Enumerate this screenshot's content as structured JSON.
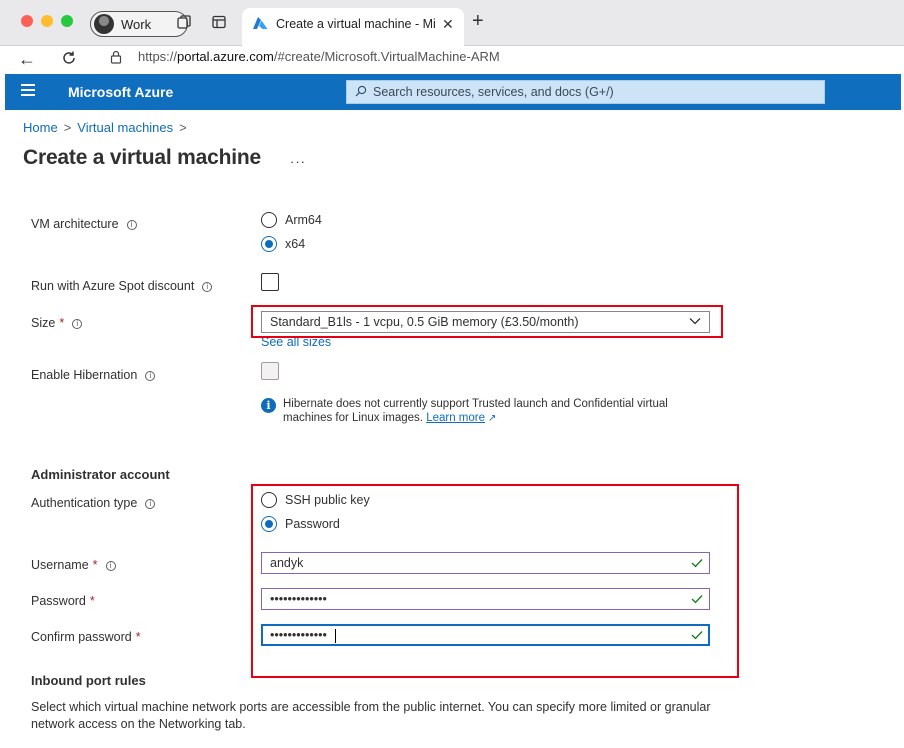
{
  "browser": {
    "profile_label": "Work",
    "tab_title": "Create a virtual machine - Microsoft Azure",
    "url_prefix": "https://",
    "url_host": "portal.azure.com",
    "url_path": "/#create/Microsoft.VirtualMachine-ARM"
  },
  "azure": {
    "brand": "Microsoft Azure",
    "search_placeholder": "Search resources, services, and docs (G+/)"
  },
  "breadcrumb": {
    "items": [
      "Home",
      "Virtual machines"
    ]
  },
  "page": {
    "title": "Create a virtual machine",
    "more_label": "···"
  },
  "form": {
    "vm_architecture": {
      "label": "VM architecture",
      "options": [
        "Arm64",
        "x64"
      ],
      "selected": "x64"
    },
    "spot": {
      "label": "Run with Azure Spot discount",
      "checked": false
    },
    "size": {
      "label": "Size",
      "value": "Standard_B1ls - 1 vcpu, 0.5 GiB memory (£3.50/month)",
      "see_all": "See all sizes"
    },
    "hibernation": {
      "label": "Enable Hibernation",
      "checked": false,
      "disabled": true,
      "note": "Hibernate does not currently support Trusted launch and Confidential virtual machines for Linux images.",
      "learn_more": "Learn more"
    },
    "admin": {
      "section_title": "Administrator account",
      "auth_type": {
        "label": "Authentication type",
        "options": [
          "SSH public key",
          "Password"
        ],
        "selected": "Password"
      },
      "username": {
        "label": "Username",
        "value": "andyk"
      },
      "password": {
        "label": "Password",
        "value": "•••••••••••••"
      },
      "confirm_password": {
        "label": "Confirm password",
        "value": "•••••••••••••"
      }
    },
    "inbound": {
      "section_title": "Inbound port rules",
      "description": "Select which virtual machine network ports are accessible from the public internet. You can specify more limited or granular network access on the Networking tab."
    }
  },
  "colors": {
    "azure_header": "#106ebe",
    "link": "#0f6cbd",
    "highlight_box": "#e60012",
    "valid_tick": "#107c10"
  },
  "symbols": {
    "required": "*",
    "info": "i",
    "breadcrumb_sep": ">",
    "ext_link": "↗"
  }
}
